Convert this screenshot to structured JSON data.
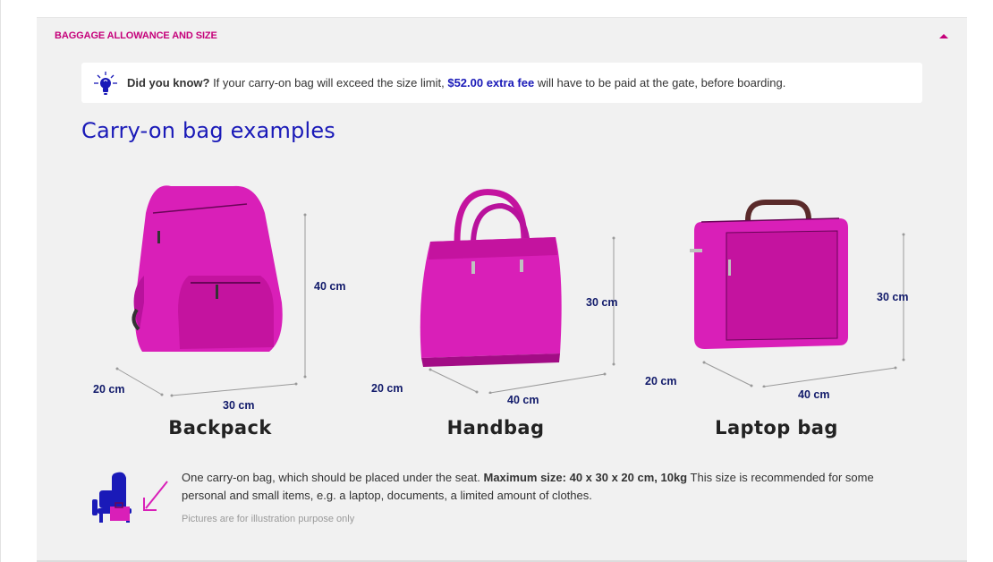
{
  "accordion": {
    "title": "BAGGAGE ALLOWANCE AND SIZE",
    "toggle_icon": "caret-up-icon",
    "accent_color": "#c5007a"
  },
  "tip": {
    "icon": "lightbulb-icon",
    "lead": "Did you know?",
    "text_before": " If your carry-on bag will exceed the size limit, ",
    "fee": "$52.00 extra fee",
    "text_after": " will have to be paid at the gate, before boarding."
  },
  "section_title": "Carry-on bag examples",
  "bags": [
    {
      "name": "Backpack",
      "height": "40 cm",
      "width": "30 cm",
      "depth": "20 cm"
    },
    {
      "name": "Handbag",
      "height": "30 cm",
      "width": "40 cm",
      "depth": "20 cm"
    },
    {
      "name": "Laptop bag",
      "height": "30 cm",
      "width": "40 cm",
      "depth": "20 cm"
    }
  ],
  "info": {
    "icon": "seat-with-bag-icon",
    "text_before": "One carry-on bag, which should be placed under the seat. ",
    "max_size": "Maximum size: 40 x 30 x 20 cm, 10kg",
    "text_after": " This size is recommended for some personal and small items, e.g. a laptop, documents, a limited amount of clothes.",
    "disclaimer": "Pictures are for illustration purpose only"
  },
  "colors": {
    "brand_blue": "#1a1ab8",
    "brand_pink": "#c5007a",
    "bag_magenta": "#d91fb8",
    "dimension_text": "#111a6a"
  }
}
